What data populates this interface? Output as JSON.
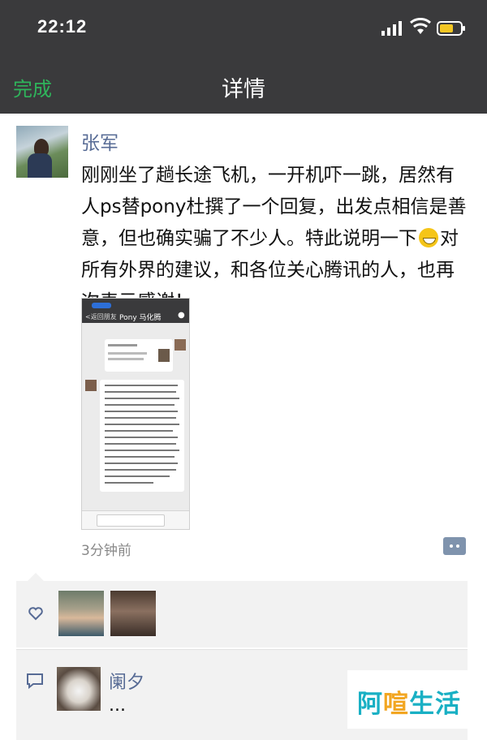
{
  "status_bar": {
    "time": "22:12"
  },
  "nav": {
    "done_label": "完成",
    "title": "详情"
  },
  "post": {
    "author": "张军",
    "text_before_emoji": "刚刚坐了趟长途飞机，一开机吓一跳，居然有人ps替pony杜撰了一个回复，出发点相信是善意，但也确实骗了不少人。特此说明一下",
    "emoji": "grinning-face",
    "text_after_emoji": "对所有外界的建议，和各位关心腾讯的人，也再次表示感谢！",
    "attached_screenshot": {
      "back_label": "<返回朋友",
      "chat_title": "Pony 马化腾"
    },
    "time_ago": "3分钟前"
  },
  "likes": {
    "count_shown": 2
  },
  "comments": [
    {
      "name": "阑夕",
      "text": "..."
    }
  ],
  "watermark": {
    "part1": "阿",
    "part2": "喧",
    "part3": "生活"
  },
  "colors": {
    "accent_green": "#2fb45b",
    "link_blue": "#576b95",
    "bar_bg": "#3a3a3c"
  }
}
